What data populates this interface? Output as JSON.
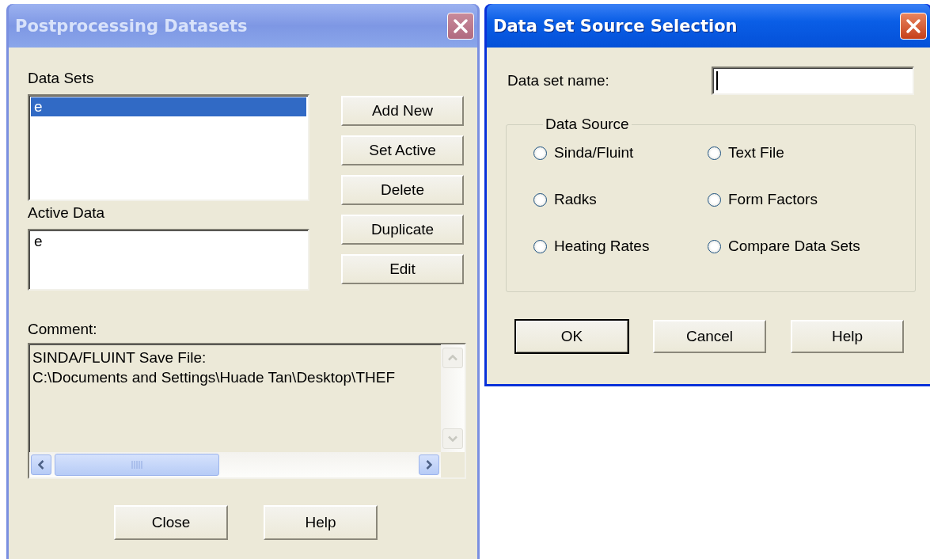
{
  "windows": [
    {
      "kind": "datasets",
      "active": false,
      "title": "Postprocessing Datasets",
      "data_sets_label": "Data Sets",
      "data_sets": [
        {
          "label": "e",
          "selected": true
        }
      ],
      "side_buttons": [
        "Add New",
        "Set Active",
        "Delete",
        "Duplicate",
        "Edit"
      ],
      "active_data_label": "Active Data",
      "active_data": [
        "e"
      ],
      "comment_label": "Comment:",
      "comment_lines": [
        "SINDA/FLUINT Save File:",
        "C:\\Documents and Settings\\Huade Tan\\Desktop\\THEF"
      ],
      "buttons": [
        {
          "label": "Close",
          "default": false
        },
        {
          "label": "Help",
          "default": false
        }
      ]
    },
    {
      "kind": "source",
      "active": true,
      "title": "Data Set Source Selection",
      "name_label": "Data set name:",
      "name_field": {
        "focused": true
      },
      "group_label": "Data Source",
      "options": [
        {
          "label": "Sinda/Fluint",
          "selected": false
        },
        {
          "label": "Text File",
          "selected": false
        },
        {
          "label": "Radks",
          "selected": false
        },
        {
          "label": "Form Factors",
          "selected": false
        },
        {
          "label": "Heating Rates",
          "selected": false
        },
        {
          "label": "Compare Data Sets",
          "selected": false
        }
      ],
      "buttons": [
        {
          "label": "OK",
          "default": true
        },
        {
          "label": "Cancel",
          "default": false
        },
        {
          "label": "Help",
          "default": false
        }
      ]
    }
  ]
}
